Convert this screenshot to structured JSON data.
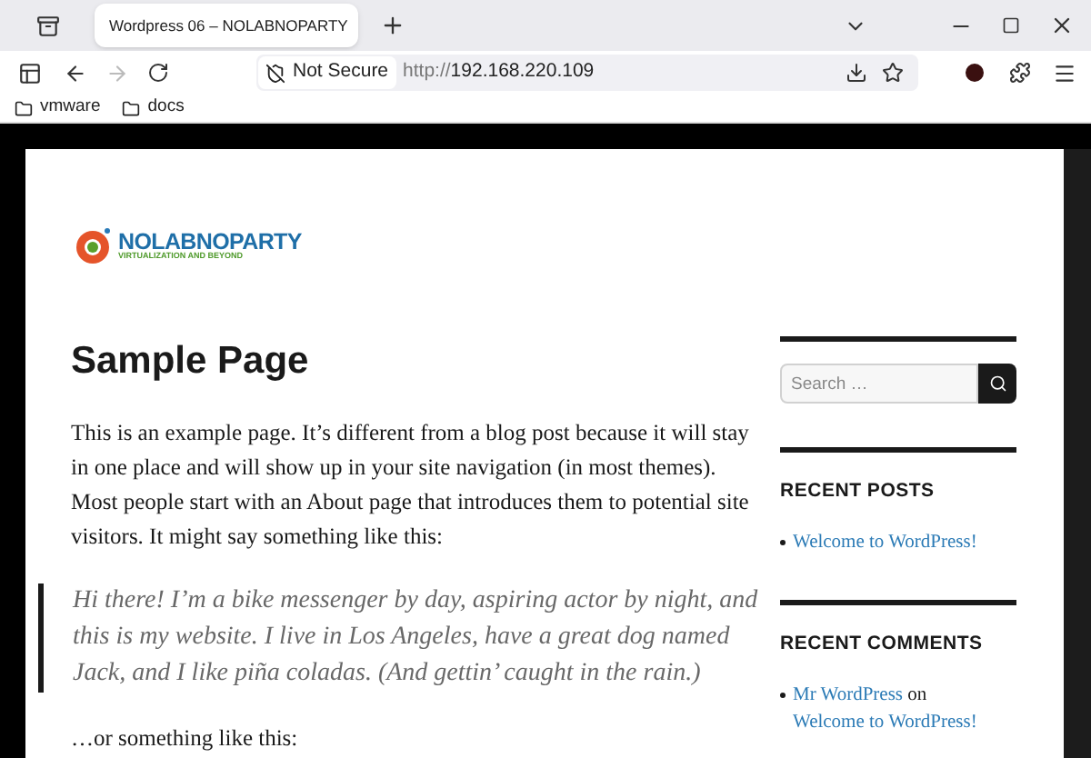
{
  "browser": {
    "tabs": [
      {
        "title": "Wordpress 06 – NOLABNOPARTY",
        "selected": true
      }
    ],
    "security": "Not Secure",
    "url_scheme": "http://",
    "url_host": "192.168.220.109",
    "bookmarks": [
      "vmware",
      "docs"
    ]
  },
  "site": {
    "logo_title": "NOLABNOPARTY",
    "logo_tagline": "VIRTUALIZATION AND BEYOND"
  },
  "article": {
    "title": "Sample Page",
    "intro": "This is an example page. It’s different from a blog post because it will stay in one place and will show up in your site navigation (in most themes). Most people start with an About page that introduces them to potential site visitors. It might say something like this:",
    "quote": "Hi there! I’m a bike messenger by day, aspiring actor by night, and this is my website. I live in Los Angeles, have a great dog named Jack, and I like piña coladas. (And gettin’ caught in the rain.)",
    "after": "…or something like this:"
  },
  "sidebar": {
    "search": {
      "placeholder": "Search …"
    },
    "widgets": [
      {
        "title": "RECENT POSTS",
        "items": [
          {
            "parts": [
              {
                "text": "Welcome to WordPress!",
                "kind": "link"
              }
            ]
          }
        ]
      },
      {
        "title": "RECENT COMMENTS",
        "items": [
          {
            "parts": [
              {
                "text": "Mr WordPress",
                "kind": "link"
              },
              {
                "text": "on",
                "kind": "text"
              },
              {
                "text": "Welcome to WordPress!",
                "kind": "link"
              }
            ]
          }
        ]
      }
    ]
  }
}
